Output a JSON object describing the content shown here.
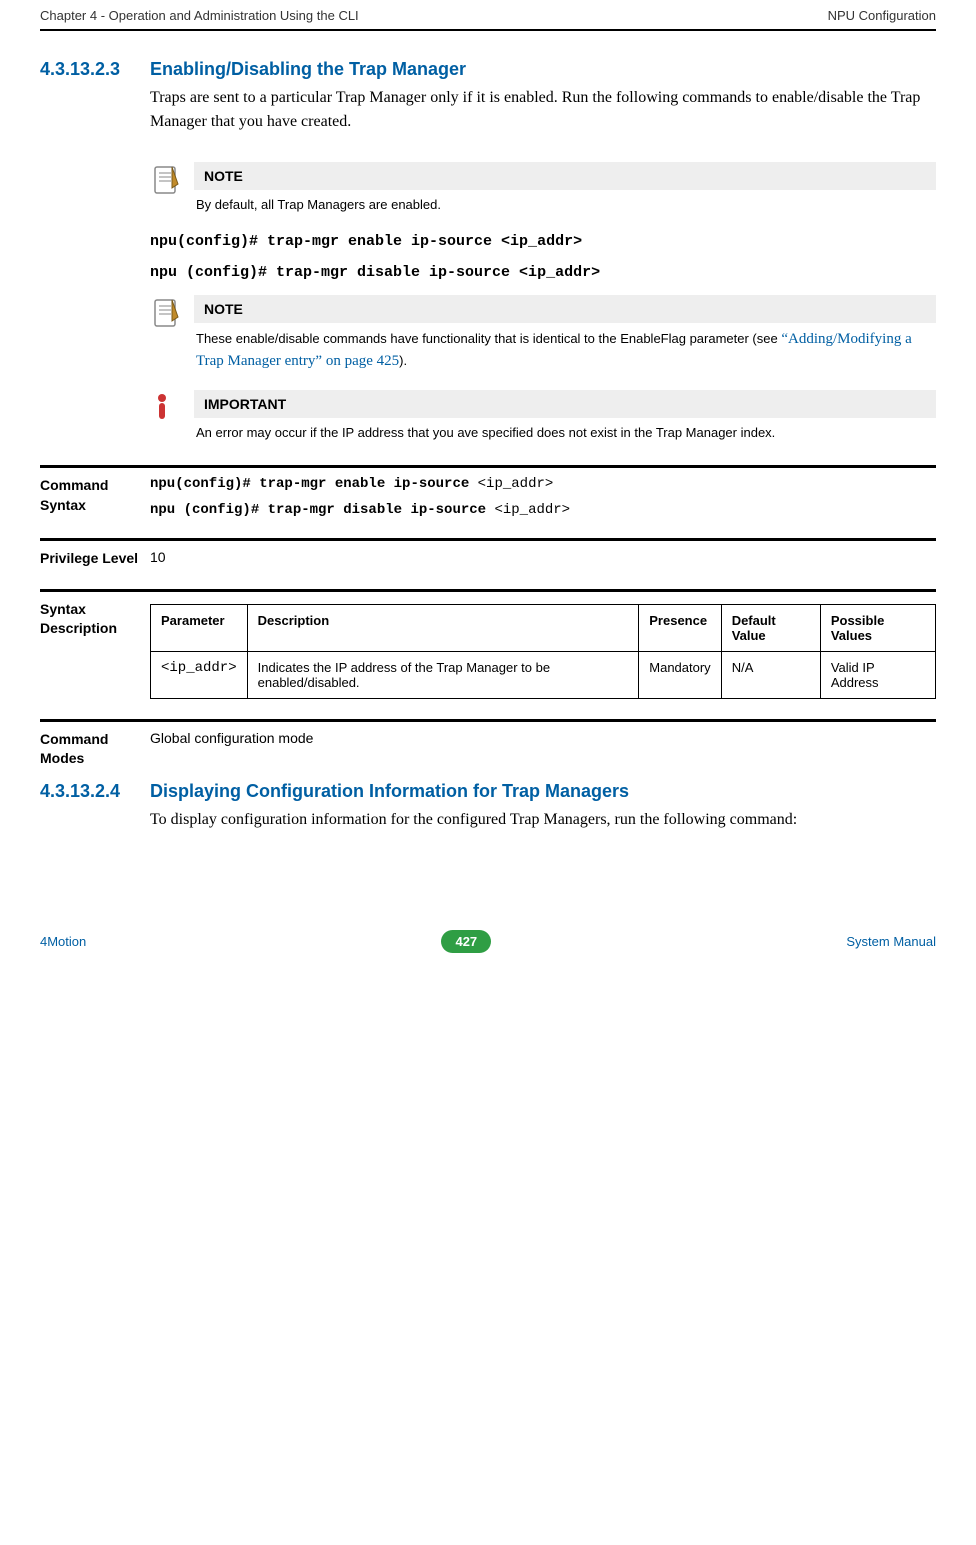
{
  "header": {
    "left": "Chapter 4 - Operation and Administration Using the CLI",
    "right": "NPU Configuration"
  },
  "sections": {
    "s1": {
      "number": "4.3.13.2.3",
      "title": "Enabling/Disabling the Trap Manager",
      "intro": "Traps are sent to a particular Trap Manager only if it is enabled. Run the following commands to enable/disable the Trap Manager that you have created."
    },
    "s2": {
      "number": "4.3.13.2.4",
      "title": "Displaying Configuration Information for Trap Managers",
      "intro": "To display configuration information for the configured Trap Managers, run the following command:"
    }
  },
  "callouts": {
    "note1": {
      "title": "NOTE",
      "text": "By default, all Trap Managers are enabled."
    },
    "note2": {
      "title": "NOTE",
      "text_prefix": "These enable/disable commands have functionality that is identical to the EnableFlag parameter (see ",
      "link": "“Adding/Modifying a Trap Manager entry” on page 425",
      "text_suffix": ")."
    },
    "important1": {
      "title": "IMPORTANT",
      "text": "An error may occur if the IP address that you ave specified does not exist in the Trap Manager index."
    }
  },
  "commands": {
    "enable": "npu(config)# trap-mgr enable ip-source <ip_addr>",
    "disable": "npu (config)# trap-mgr disable ip-source <ip_addr>"
  },
  "defs": {
    "command_syntax": {
      "label": "Command Syntax",
      "line1_prefix": "npu(config)#  trap-mgr enable ip-source ",
      "line1_arg": "<ip_addr>",
      "line2_prefix": "npu (config)# trap-mgr disable ip-source ",
      "line2_arg": "<ip_addr>"
    },
    "privilege": {
      "label": "Privilege Level",
      "value": "10"
    },
    "syntax_desc": {
      "label": "Syntax Description",
      "headers": {
        "param": "Parameter",
        "desc": "Description",
        "presence": "Presence",
        "default": "Default Value",
        "possible": "Possible Values"
      },
      "row": {
        "param": "<ip_addr>",
        "desc": "Indicates the IP address of the Trap Manager to be enabled/disabled.",
        "presence": "Mandatory",
        "default": "N/A",
        "possible": "Valid IP Address"
      }
    },
    "command_modes": {
      "label": "Command Modes",
      "value": "Global configuration mode"
    }
  },
  "footer": {
    "left": "4Motion",
    "page": "427",
    "right": "System Manual"
  }
}
